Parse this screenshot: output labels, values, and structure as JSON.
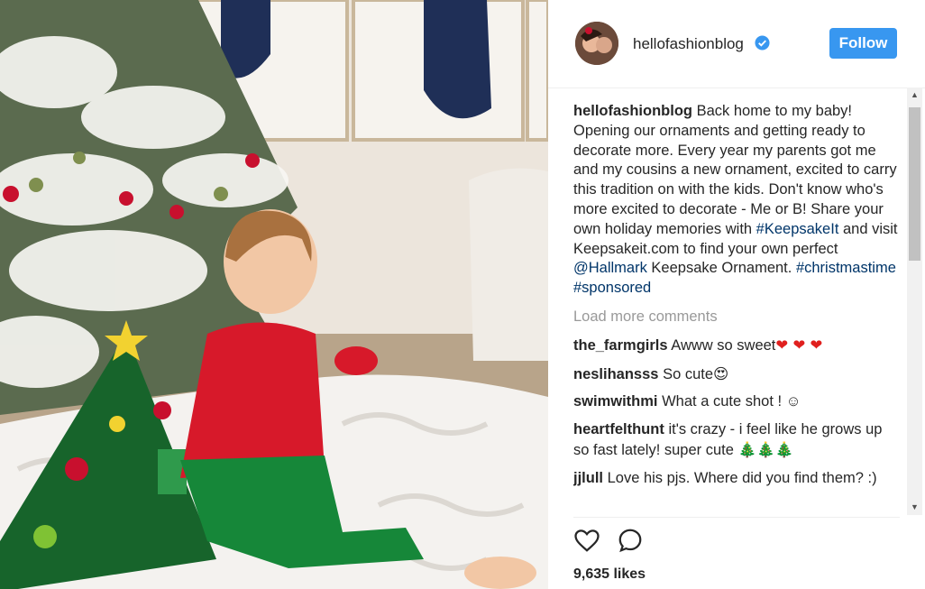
{
  "post": {
    "username": "hellofashionblog",
    "follow_label": "Follow",
    "caption": {
      "username": "hellofashionblog",
      "text_before_tag1": "Back home to my baby! Opening our ornaments and getting ready to decorate more. Every year my parents got me and my cousins a new ornament, excited to carry this tradition on with the kids. Don't know who's more excited to decorate - Me or B! Share your own holiday memories with ",
      "tag1": "#KeepsakeIt",
      "text_between": " and visit Keepsakeit.com to find your own perfect ",
      "tag2": "@Hallmark",
      "text_after_tag2": " Keepsake Ornament. ",
      "tag3": "#christmastime",
      "tag4": "#sponsored"
    },
    "load_more": "Load more comments",
    "comments": [
      {
        "user": "the_farmgirls",
        "text": "Awww so sweet",
        "emoji": "❤ ❤ ❤"
      },
      {
        "user": "neslihansss",
        "text": "So cute",
        "emoji": "😍"
      },
      {
        "user": "swimwithmi",
        "text": "What a cute shot ! ☺",
        "emoji": ""
      },
      {
        "user": "heartfelthunt",
        "text": "it's crazy - i feel like he grows up so fast lately! super cute",
        "emoji": "🎄🎄🎄"
      },
      {
        "user": "jjlull",
        "text": "Love his pjs. Where did you find them?",
        "emoji": ":)"
      }
    ],
    "likes": "9,635 likes",
    "colors": {
      "follow": "#3897f0",
      "link": "#003569",
      "muted": "#999999",
      "verified": "#3897f0"
    },
    "icons": [
      "verified-badge-icon",
      "heart-icon",
      "comment-icon",
      "scroll-up-icon",
      "scroll-down-icon"
    ]
  }
}
